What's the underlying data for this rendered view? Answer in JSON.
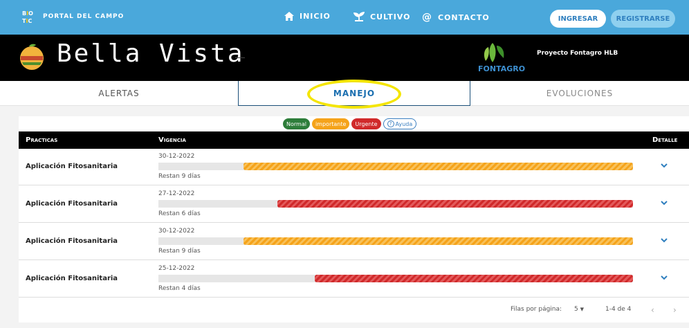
{
  "topbar": {
    "logo": "BIOTIC",
    "portal_label": "PORTAL DEL CAMPO",
    "nav": [
      {
        "label": "INICIO",
        "icon": "home-icon"
      },
      {
        "label": "CULTIVO",
        "icon": "sprout-icon"
      },
      {
        "label": "CONTACTO",
        "icon": "at-icon"
      }
    ],
    "login_label": "INGRESAR",
    "register_label": "REGISTRARSE"
  },
  "hero": {
    "title": "Bella Vista",
    "partner_logo_text": "FONTAGRO",
    "project_label": "Proyecto Fontagro HLB"
  },
  "tabs": [
    {
      "label": "ALERTAS",
      "active": false
    },
    {
      "label": "MANEJO",
      "active": true
    },
    {
      "label": "EVOLUCIONES",
      "active": false
    }
  ],
  "legend": {
    "normal": "Normal",
    "importante": "importante",
    "urgente": "Urgente",
    "ayuda": "Ayuda"
  },
  "table": {
    "headers": {
      "practicas": "Practicas",
      "vigencia": "Vigencia",
      "detalle": "Detalle"
    },
    "rows": [
      {
        "practica": "Aplicación Fitosanitaria",
        "fecha": "30-12-2022",
        "restan": "Restan 9 días",
        "level": "importante",
        "fill": 0.82
      },
      {
        "practica": "Aplicación Fitosanitaria",
        "fecha": "27-12-2022",
        "restan": "Restan 6 días",
        "level": "urgente",
        "fill": 0.75
      },
      {
        "practica": "Aplicación Fitosanitaria",
        "fecha": "30-12-2022",
        "restan": "Restan 9 días",
        "level": "importante",
        "fill": 0.82
      },
      {
        "practica": "Aplicación Fitosanitaria",
        "fecha": "25-12-2022",
        "restan": "Restan 4 días",
        "level": "urgente",
        "fill": 0.67
      }
    ]
  },
  "pagination": {
    "rows_per_page_label": "Filas por página:",
    "rows_per_page_value": "5",
    "range": "1-4 de 4"
  },
  "colors": {
    "topbar": "#4aa8db",
    "normal": "#2d7d3a",
    "importante": "#f5a31a",
    "urgente": "#d0292a",
    "highlight": "#f4e500"
  }
}
